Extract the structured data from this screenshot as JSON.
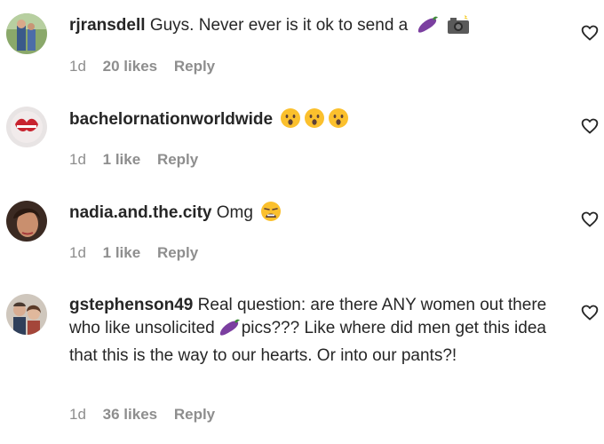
{
  "comments": [
    {
      "username": "rjransdell",
      "text_parts": [
        "Guys. Never ever is it ok to send a"
      ],
      "emojis": [
        "eggplant-emoji",
        "camera-flash-emoji"
      ],
      "time": "1d",
      "likes": "20 likes",
      "reply": "Reply"
    },
    {
      "username": "bachelornationworldwide",
      "text_parts": [],
      "emojis": [
        "astonished-face-emoji",
        "astonished-face-emoji",
        "astonished-face-emoji"
      ],
      "time": "1d",
      "likes": "1 like",
      "reply": "Reply"
    },
    {
      "username": "nadia.and.the.city",
      "text_parts": [
        "Omg"
      ],
      "emojis": [
        "weary-face-emoji"
      ],
      "time": "1d",
      "likes": "1 like",
      "reply": "Reply"
    },
    {
      "username": "gstephenson49",
      "text_parts": [
        "Real question: are there ANY women out there who like unsolicited",
        "pics??? Like where did men get this idea that this is the way to our hearts. Or into our pants?!"
      ],
      "emojis": [
        "eggplant-emoji"
      ],
      "time": "1d",
      "likes": "36 likes",
      "reply": "Reply"
    }
  ],
  "colors": {
    "text": "#262626",
    "meta": "#8e8e8e",
    "heart_stroke": "#262626",
    "eggplant": "#7b3fa0"
  }
}
